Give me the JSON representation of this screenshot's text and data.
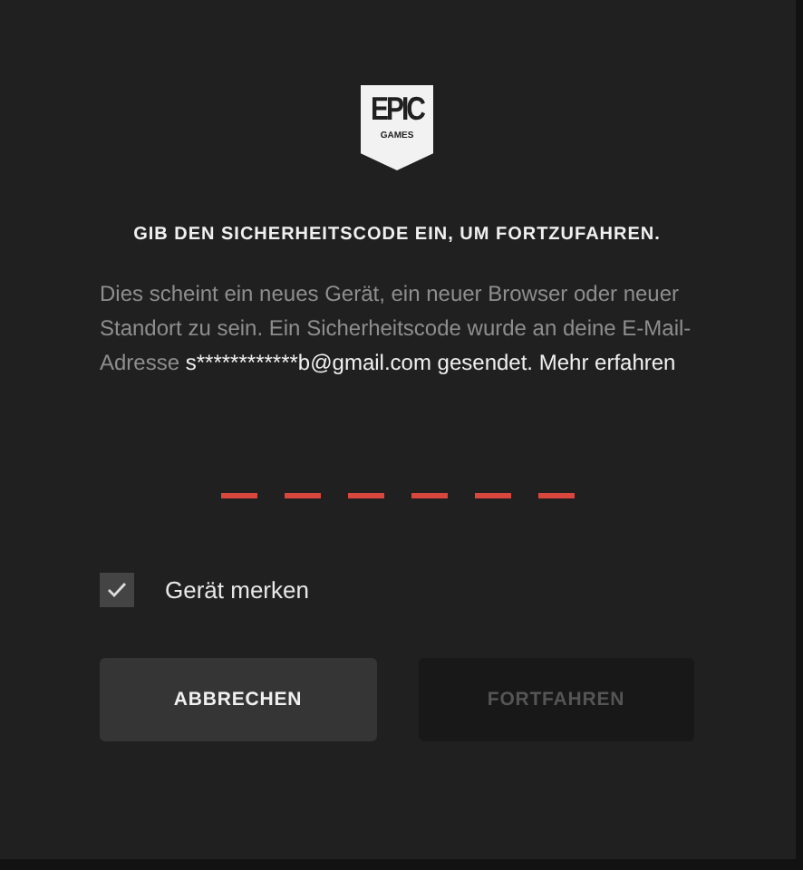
{
  "logo": {
    "wordmark": "EPIC",
    "subtitle": "GAMES"
  },
  "heading": "GIB DEN SICHERHEITSCODE EIN, UM FORTZUFAHREN.",
  "message": {
    "text": "Dies scheint ein neues Gerät, ein neuer Browser oder neuer Standort zu sein. Ein Sicherheitscode wurde an deine E-Mail-Adresse",
    "email": "s************b@gmail.com",
    "text_end": "gesendet.",
    "link": "Mehr erfahren"
  },
  "code_slots": [
    {
      "filled": false
    },
    {
      "filled": false
    },
    {
      "filled": false
    },
    {
      "filled": false
    },
    {
      "filled": false
    },
    {
      "filled": false
    }
  ],
  "remember": {
    "label": "Gerät merken",
    "checked": true
  },
  "buttons": [
    {
      "label": "ABBRECHEN",
      "disabled": false
    },
    {
      "label": "FORTFAHREN",
      "disabled": true
    }
  ]
}
